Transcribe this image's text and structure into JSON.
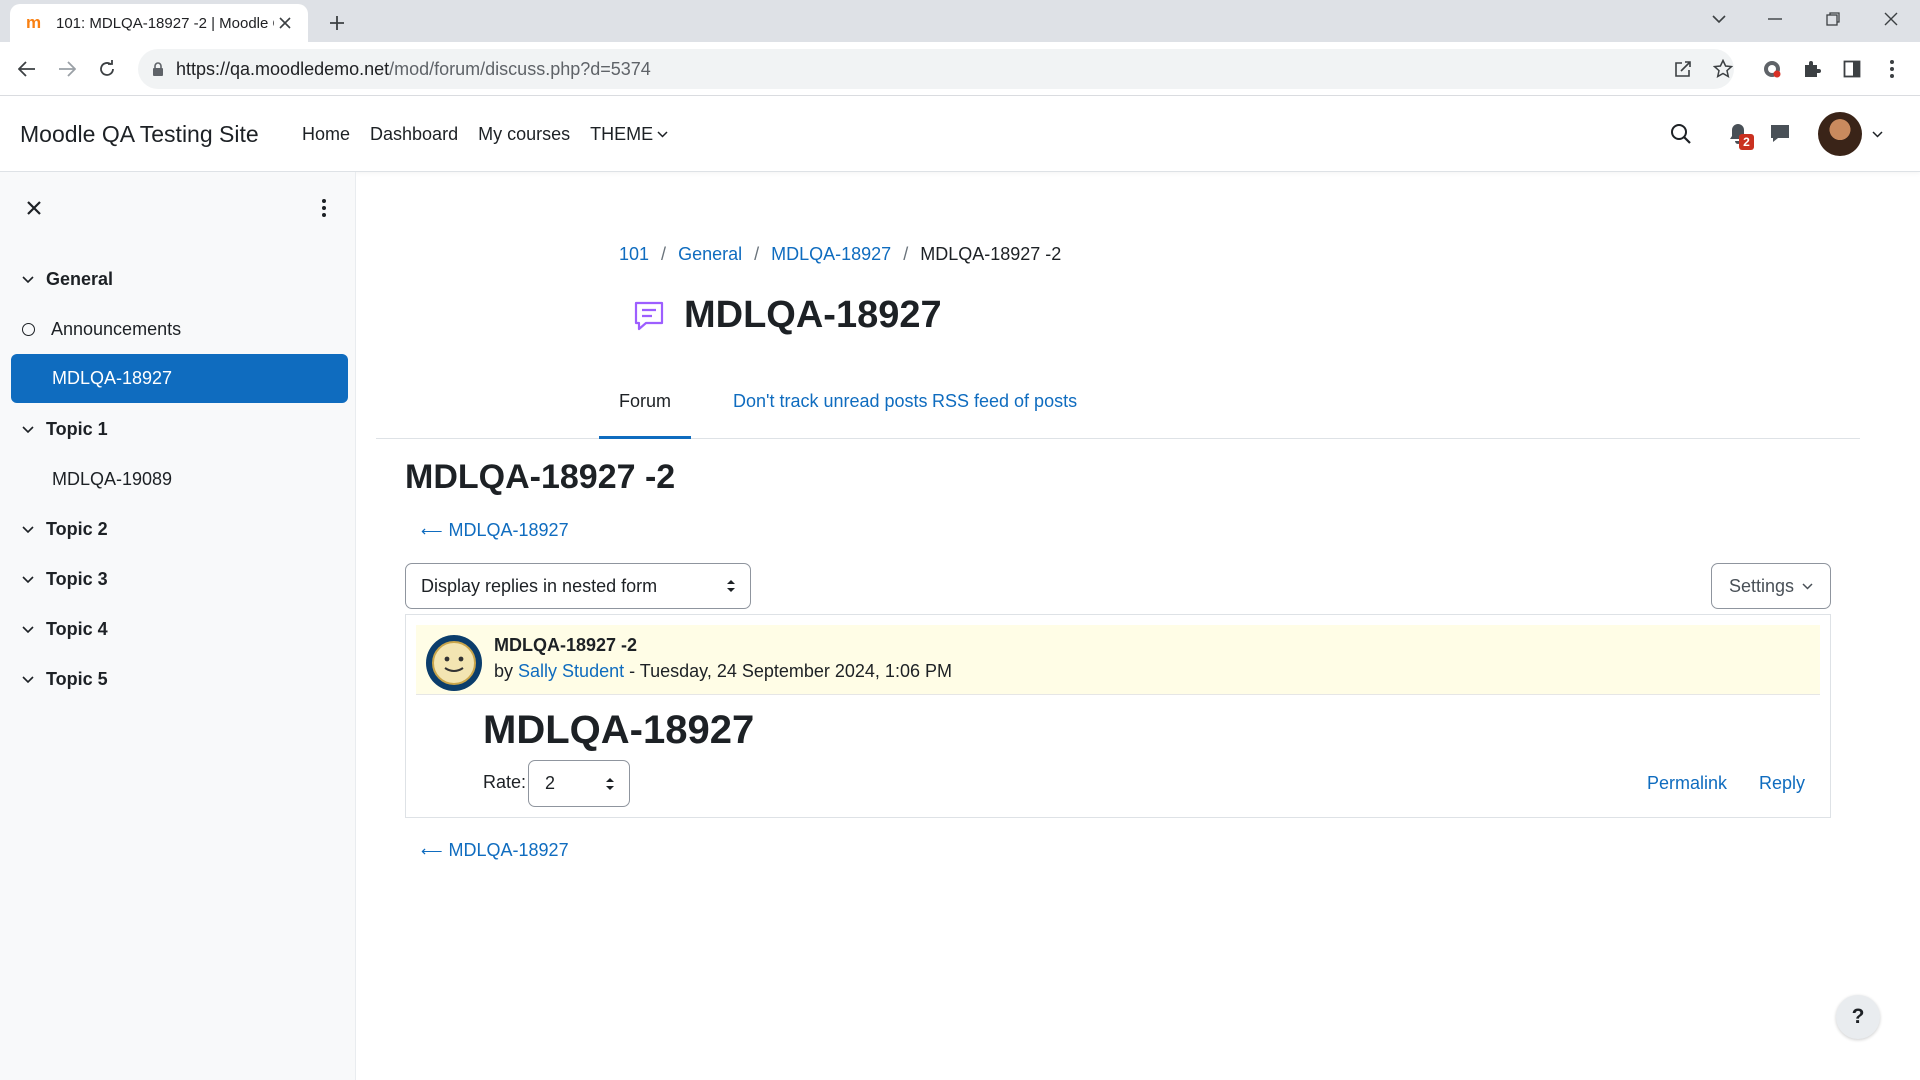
{
  "browser": {
    "tab_title": "101: MDLQA-18927 -2 | Moodle QA",
    "favicon_text": "m",
    "url_host": "https://qa.moodledemo.net",
    "url_path": "/mod/forum/discuss.php?d=5374"
  },
  "navbar": {
    "site_name": "Moodle QA Testing Site",
    "links": [
      "Home",
      "Dashboard",
      "My courses",
      "THEME"
    ],
    "notification_count": "2"
  },
  "drawer": {
    "sections": [
      {
        "label": "General"
      },
      {
        "label": "Topic 1"
      },
      {
        "label": "Topic 2"
      },
      {
        "label": "Topic 3"
      },
      {
        "label": "Topic 4"
      },
      {
        "label": "Topic 5"
      }
    ],
    "activities": {
      "announcements": "Announcements",
      "active": "MDLQA-18927",
      "topic1_item": "MDLQA-19089"
    }
  },
  "breadcrumb": [
    "101",
    "General",
    "MDLQA-18927",
    "MDLQA-18927 -2"
  ],
  "page": {
    "title": "MDLQA-18927",
    "tabs": [
      "Forum",
      "Don't track unread posts",
      "RSS feed of posts"
    ],
    "discussion_title": "MDLQA-18927 -2",
    "back_link": "MDLQA-18927",
    "display_mode": "Display replies in nested form",
    "settings_label": "Settings"
  },
  "post": {
    "subject": "MDLQA-18927 -2",
    "by": "by",
    "author": "Sally Student",
    "date": " - Tuesday, 24 September 2024, 1:06 PM",
    "content": "MDLQA-18927",
    "rate_label": "Rate:",
    "rate_value": "2",
    "permalink": "Permalink",
    "reply": "Reply"
  },
  "help": "?",
  "colors": {
    "brand_blue": "#0f6cbf",
    "post_header_bg": "#fffde6",
    "forum_icon": "#9d5eff",
    "badge_red": "#ca3120"
  }
}
